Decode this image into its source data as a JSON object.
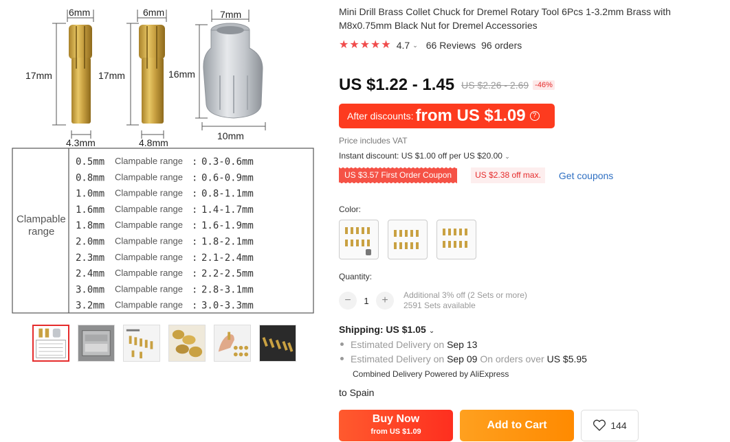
{
  "gallery": {
    "dimensions": {
      "c1_top": "6mm",
      "c2_top": "6mm",
      "nut_top": "7mm",
      "c1_left": "17mm",
      "c2_left": "17mm",
      "nut_left": "16mm",
      "c1_bottom": "4.3mm",
      "c2_bottom": "4.8mm",
      "nut_bottom": "10mm"
    },
    "range_table": {
      "side_label_line1": "Clampable",
      "side_label_line2": "range",
      "rows": [
        {
          "size": "0.5mm",
          "label": "Clampable range",
          "sep": ":",
          "range": "0.3-0.6mm"
        },
        {
          "size": "0.8mm",
          "label": "Clampable range",
          "sep": ":",
          "range": "0.6-0.9mm"
        },
        {
          "size": "1.0mm",
          "label": "Clampable range",
          "sep": ":",
          "range": "0.8-1.1mm"
        },
        {
          "size": "1.6mm",
          "label": "Clampable range",
          "sep": ":",
          "range": "1.4-1.7mm"
        },
        {
          "size": "1.8mm",
          "label": "Clampable range",
          "sep": ":",
          "range": "1.6-1.9mm"
        },
        {
          "size": "2.0mm",
          "label": "Clampable range",
          "sep": ":",
          "range": "1.8-2.1mm"
        },
        {
          "size": "2.3mm",
          "label": "Clampable range",
          "sep": ":",
          "range": "2.1-2.4mm"
        },
        {
          "size": "2.4mm",
          "label": "Clampable range",
          "sep": ":",
          "range": "2.2-2.5mm"
        },
        {
          "size": "3.0mm",
          "label": "Clampable range",
          "sep": ":",
          "range": "2.8-3.1mm"
        },
        {
          "size": "3.2mm",
          "label": "Clampable range",
          "sep": ":",
          "range": "3.0-3.3mm"
        }
      ]
    },
    "thumbnails": [
      "thumb-spec-sheet",
      "thumb-boxed-set",
      "thumb-collet-layout",
      "thumb-brass-closeup",
      "thumb-hand-holding",
      "thumb-dark-background"
    ]
  },
  "product": {
    "title": "Mini Drill Brass Collet Chuck for Dremel Rotary Tool 6Pcs 1-3.2mm Brass with M8x0.75mm Black Nut for Dremel Accessories",
    "rating": "4.7",
    "reviews": "66 Reviews",
    "orders": "96 orders",
    "price": "US $1.22 - 1.45",
    "price_old": "US $2.26 - 2.69",
    "discount_pct": "-46%",
    "after_discount_label": "After discounts:",
    "after_discount_value": "from US $1.09",
    "vat_note": "Price includes VAT",
    "instant_discount": "Instant discount: US $1.00 off per US $20.00",
    "coupon_first_order": "US $3.57 First Order Coupon",
    "coupon_max": "US $2.38 off max.",
    "get_coupons": "Get coupons",
    "color_label": "Color:",
    "quantity_label": "Quantity:",
    "quantity_value": "1",
    "quantity_note_line1": "Additional 3% off (2 Sets or more)",
    "quantity_note_line2": "2591 Sets available"
  },
  "shipping": {
    "title": "Shipping: US $1.05",
    "line1_prefix": "Estimated Delivery on",
    "line1_date": "Sep 13",
    "line2_prefix": "Estimated Delivery on",
    "line2_date": "Sep 09",
    "line2_mid": "On orders over",
    "line2_amount": "US $5.95",
    "combined": "Combined Delivery Powered by AliExpress",
    "destination": "to Spain"
  },
  "actions": {
    "buy_now": "Buy Now",
    "buy_now_sub": "from US $1.09",
    "add_to_cart": "Add to Cart",
    "wishlist_count": "144"
  },
  "colors": {
    "accent_red": "#fd3b1f",
    "cart_orange": "#ff8a00",
    "link_blue": "#2e6fc2",
    "star_red": "#f04b4b"
  }
}
